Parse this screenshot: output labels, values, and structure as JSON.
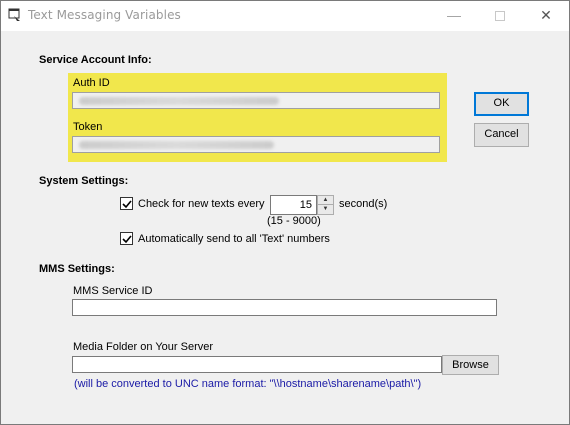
{
  "window": {
    "title": "Text Messaging Variables"
  },
  "service_account": {
    "heading": "Service Account Info:",
    "auth_id_label": "Auth ID",
    "token_label": "Token"
  },
  "buttons": {
    "ok": "OK",
    "cancel": "Cancel",
    "browse": "Browse"
  },
  "system_settings": {
    "heading": "System Settings:",
    "check_new_texts": {
      "label": "Check for new texts every",
      "checked": true
    },
    "interval": {
      "value": "15",
      "unit": "second(s)",
      "range": "(15 - 9000)"
    },
    "auto_send": {
      "label": "Automatically send to all 'Text' numbers",
      "checked": true
    }
  },
  "mms_settings": {
    "heading": "MMS Settings:",
    "service_id_label": "MMS Service ID",
    "media_folder_label": "Media Folder on Your Server",
    "unc_note": "(will be converted to UNC name format: \"\\\\hostname\\sharename\\path\\\")"
  },
  "colors": {
    "highlight": "#f1e74c",
    "note_text": "#1a1aa6",
    "default_button_border": "#0078d7"
  },
  "icons": [
    "app-icon",
    "minimize-icon",
    "maximize-icon",
    "close-icon",
    "checkmark-icon",
    "spin-up-icon",
    "spin-down-icon"
  ]
}
